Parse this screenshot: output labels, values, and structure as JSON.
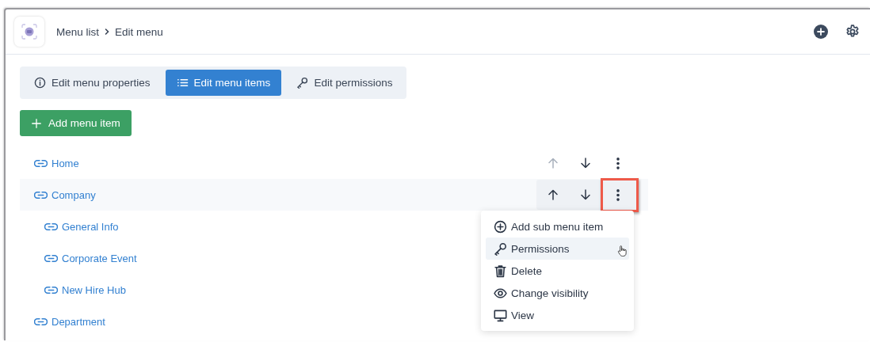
{
  "header": {
    "breadcrumb": [
      {
        "label": "Menu list"
      },
      {
        "label": "Edit menu"
      }
    ]
  },
  "tabs": [
    {
      "label": "Edit menu properties",
      "kind": "info",
      "selected": false
    },
    {
      "label": "Edit menu items",
      "kind": "list",
      "selected": true
    },
    {
      "label": "Edit permissions",
      "kind": "key",
      "selected": false
    }
  ],
  "add_button": {
    "label": "Add menu item"
  },
  "menu_items": [
    {
      "label": "Home",
      "hovered": false,
      "up_disabled": true,
      "menu_open": false
    },
    {
      "label": "Company",
      "hovered": true,
      "up_disabled": false,
      "menu_open": true,
      "children": [
        {
          "label": "General Info"
        },
        {
          "label": "Corporate Event"
        },
        {
          "label": "New Hire Hub"
        }
      ]
    },
    {
      "label": "Department"
    }
  ],
  "context_menu": [
    {
      "label": "Add sub menu item",
      "kind": "add",
      "hovered": false
    },
    {
      "label": "Permissions",
      "kind": "permissions",
      "hovered": true
    },
    {
      "label": "Delete",
      "kind": "delete",
      "hovered": false
    },
    {
      "label": "Change visibility",
      "kind": "visibility",
      "hovered": false
    },
    {
      "label": "View",
      "kind": "view",
      "hovered": false
    }
  ]
}
